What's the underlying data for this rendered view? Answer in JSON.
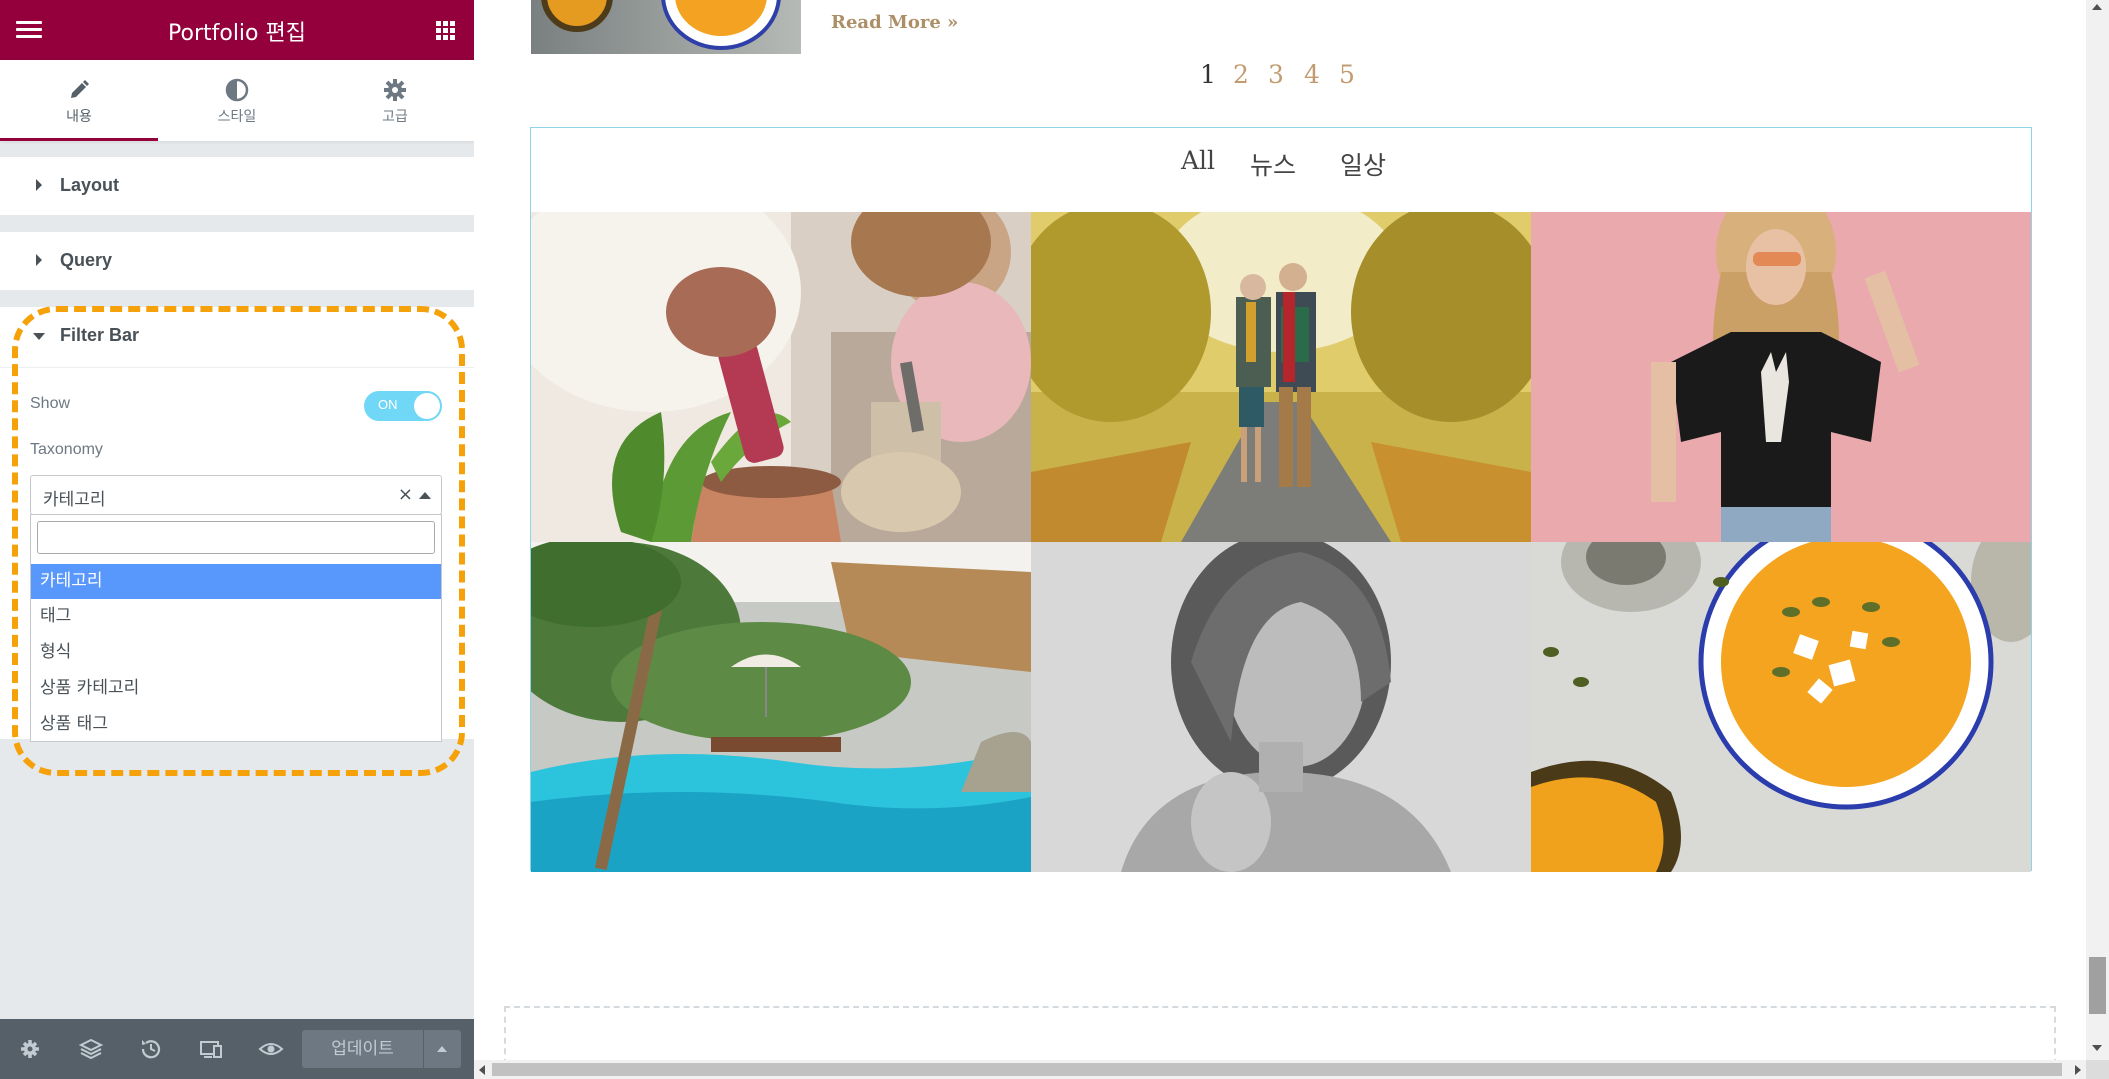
{
  "editor": {
    "title": "Portfolio 편집",
    "tabs": [
      {
        "label": "내용",
        "icon": "pencil-icon",
        "active": true
      },
      {
        "label": "스타일",
        "icon": "contrast-icon",
        "active": false
      },
      {
        "label": "고급",
        "icon": "gear-icon",
        "active": false
      }
    ],
    "sections": {
      "layout": "Layout",
      "query": "Query",
      "filter_bar": "Filter Bar"
    },
    "filter_bar": {
      "show_label": "Show",
      "show_toggle": "ON",
      "taxonomy_label": "Taxonomy",
      "taxonomy_value": "카테고리",
      "clear_symbol": "×",
      "search_value": "",
      "options": [
        "카테고리",
        "태그",
        "형식",
        "상품 카테고리",
        "상품 태그"
      ],
      "selected_option": "카테고리"
    },
    "footer": {
      "icons": [
        "gear-icon",
        "layers-icon",
        "history-icon",
        "responsive-icon",
        "eye-icon"
      ],
      "update_label": "업데이트"
    },
    "collapse_symbol": "‹"
  },
  "preview": {
    "read_more": "Read More »",
    "pagination": [
      "1",
      "2",
      "3",
      "4",
      "5"
    ],
    "current_page": "1",
    "filters": [
      "All",
      "뉴스",
      "일상"
    ],
    "tiles": [
      "gardening-photo",
      "couple-walking-photo",
      "woman-pink-wall-photo",
      "pool-resort-photo",
      "bw-portrait-photo",
      "pumpkin-soup-photo"
    ]
  },
  "colors": {
    "brand": "#93003c",
    "toggle": "#71d7f7",
    "selected_option": "#5897fb",
    "highlight": "#f5a20a",
    "link": "#ad8f67",
    "border": "#8fd5ea"
  }
}
